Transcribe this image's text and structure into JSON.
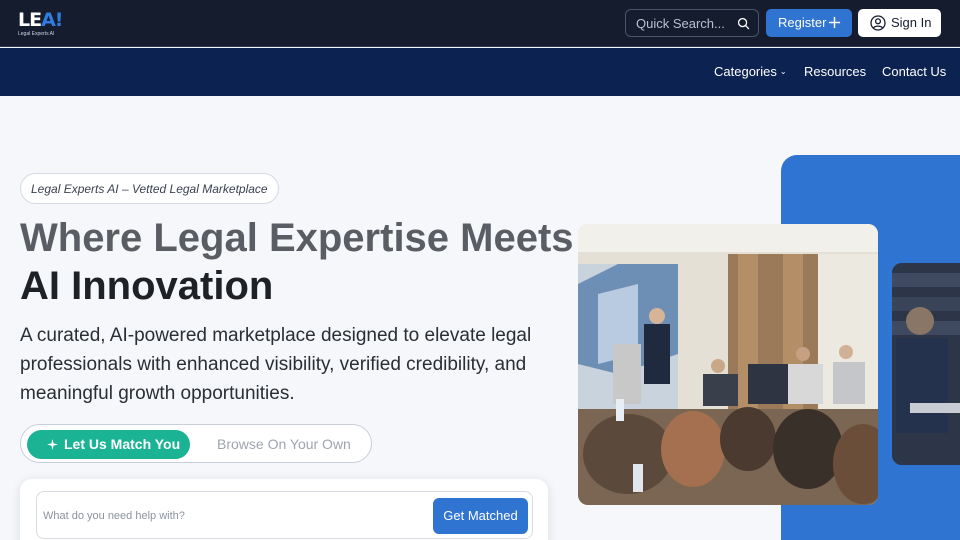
{
  "brand": {
    "logo_text": "LEA!",
    "logo_subtitle": "Legal Experts AI"
  },
  "header": {
    "search_placeholder": "Quick Search...",
    "register_label": "Register",
    "signin_label": "Sign In"
  },
  "nav": {
    "items": [
      "Categories",
      "Resources",
      "Contact Us"
    ]
  },
  "hero": {
    "badge": "Legal Experts AI – Vetted Legal Marketplace",
    "headline_line1": "Where Legal Expertise Meets",
    "headline_line2": "AI Innovation",
    "subtext": "A curated, AI-powered marketplace designed to elevate legal professionals with enhanced visibility, verified credibility, and meaningful growth opportunities.",
    "toggle": {
      "active": "Let Us Match You",
      "inactive": "Browse On Your Own"
    }
  },
  "match_card": {
    "input_placeholder": "What do you need help with?",
    "button_label": "Get Matched"
  },
  "colors": {
    "topbar": "#141c2e",
    "navbar": "#0c2250",
    "accent_blue": "#2f74d0",
    "accent_teal": "#1ab394"
  },
  "icons": [
    "search-icon",
    "plus-icon",
    "user-icon",
    "chevron-down-icon",
    "sparkle-icon"
  ]
}
